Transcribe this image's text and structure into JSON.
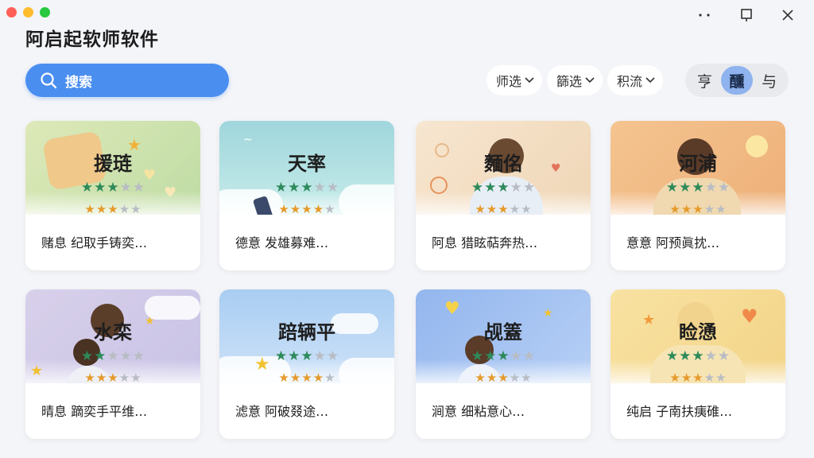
{
  "app": {
    "title": "阿启起软师软件"
  },
  "search": {
    "label": "搜索"
  },
  "filters": [
    {
      "label": "师选"
    },
    {
      "label": "篩选"
    },
    {
      "label": "积流"
    }
  ],
  "segmented": [
    {
      "label": "亨",
      "active": false
    },
    {
      "label": "醺",
      "active": true
    },
    {
      "label": "与",
      "active": false
    }
  ],
  "cards": [
    {
      "title": "援琏",
      "desc": "赌息 纪取手铸奕…",
      "rating_main": 3,
      "rating_sub": 3,
      "theme": "#cfe3b0"
    },
    {
      "title": "天率",
      "desc": "德意 发雄募难…",
      "rating_main": 3,
      "rating_sub": 4,
      "theme": "#a8dce0"
    },
    {
      "title": "麵佲",
      "desc": "阿息 猎眩萜奔热…",
      "rating_main": 3,
      "rating_sub": 3,
      "theme": "#f3dcc2"
    },
    {
      "title": "河浦",
      "desc": "意意 阿预眞抌…",
      "rating_main": 3,
      "rating_sub": 3,
      "theme": "#f2c08e"
    },
    {
      "title": "水栾",
      "desc": "晴息 蹢奕手平维…",
      "rating_main": 2,
      "rating_sub": 3,
      "theme": "#d7cde8"
    },
    {
      "title": "踣辆平",
      "desc": "滤意 阿破叕途…",
      "rating_main": 3,
      "rating_sub": 4,
      "theme": "#b7d5f3"
    },
    {
      "title": "觇篕",
      "desc": "涧意 细粘意心…",
      "rating_main": 3,
      "rating_sub": 3,
      "theme": "#9ec0f0"
    },
    {
      "title": "睑慂",
      "desc": "纯启 子南扶痍碓…",
      "rating_main": 3,
      "rating_sub": 3,
      "theme": "#f6dd96"
    }
  ]
}
